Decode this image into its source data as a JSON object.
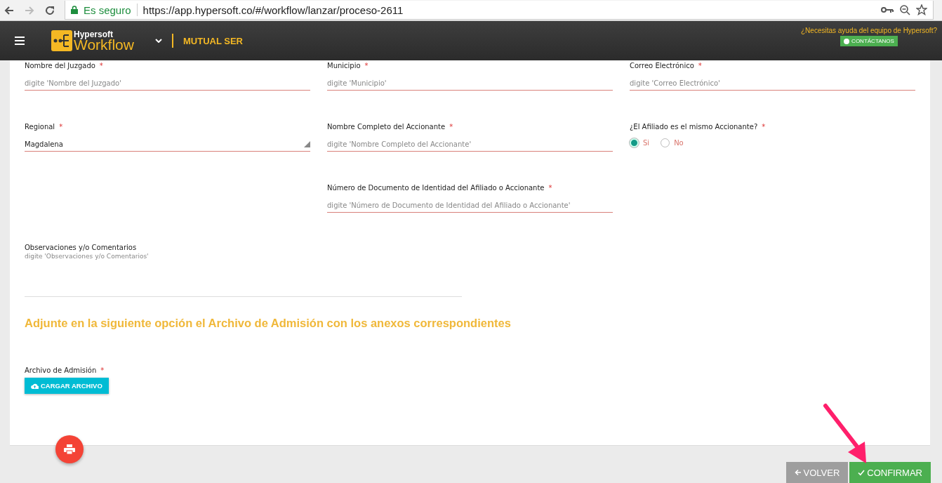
{
  "browser": {
    "security_label": "Es seguro",
    "url": "https://app.hypersoft.co/#/workflow/lanzar/proceso-2611"
  },
  "header": {
    "logo_top": "Hypersoft",
    "logo_bottom": "Workflow",
    "company": "MUTUAL SER",
    "help_text": "¿Necesitas ayuda del equipo de Hypersoft?",
    "contact_button": "CONTÁCTANOS"
  },
  "form": {
    "columns": [
      [
        {
          "kind": "text",
          "label": "Nombre del Juzgado",
          "required": true,
          "placeholder": "digite 'Nombre del Juzgado'"
        },
        {
          "kind": "select",
          "label": "Regional",
          "required": true,
          "value": "Magdalena"
        }
      ],
      [
        {
          "kind": "text",
          "label": "Municipio",
          "required": true,
          "placeholder": "digite 'Municipio'"
        },
        {
          "kind": "text",
          "label": "Nombre Completo del Accionante",
          "required": true,
          "placeholder": "digite 'Nombre Completo del Accionante'"
        },
        {
          "kind": "text",
          "label": "Número de Documento de Identidad del Afiliado o Accionante",
          "required": true,
          "placeholder": "digite 'Número de Documento de Identidad del Afiliado o Accionante'"
        }
      ],
      [
        {
          "kind": "text",
          "label": "Correo Electrónico",
          "required": true,
          "placeholder": "digite 'Correo Electrónico'"
        },
        {
          "kind": "radio",
          "label": "¿El Afiliado es el mismo Accionante?",
          "required": true,
          "options": [
            {
              "label": "Si",
              "selected": true
            },
            {
              "label": "No",
              "selected": false
            }
          ]
        }
      ]
    ],
    "required_mark": "*",
    "comments": {
      "label": "Observaciones y/o Comentarios",
      "placeholder": "digite 'Observaciones y/o Comentarios'"
    },
    "section_heading": "Adjunte en la siguiente opción el Archivo de Admisión con los anexos correspondientes",
    "upload": {
      "label": "Archivo de Admisión",
      "required": true,
      "button": "CARGAR ARCHIVO"
    }
  },
  "footer": {
    "back_button": "VOLVER",
    "confirm_button": "CONFIRMAR"
  }
}
